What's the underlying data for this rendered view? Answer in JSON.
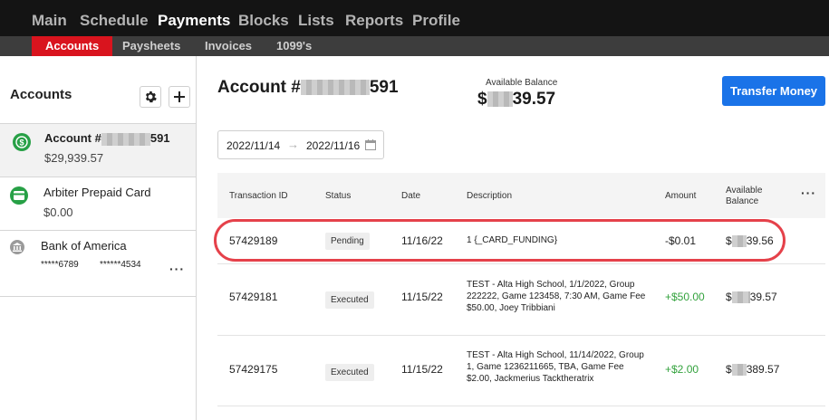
{
  "top_nav": [
    "Main",
    "Schedule",
    "Payments",
    "Blocks",
    "Lists",
    "Reports",
    "Profile"
  ],
  "sub_nav": [
    "Accounts",
    "Paysheets",
    "Invoices",
    "1099's"
  ],
  "sidebar": {
    "title": "Accounts",
    "accounts": [
      {
        "name_prefix": "Account #",
        "name_suffix": "591",
        "balance": "$29,939.57",
        "icon": "dollar-circle-icon"
      },
      {
        "name": "Arbiter Prepaid Card",
        "balance": "$0.00",
        "icon": "card-icon"
      },
      {
        "name": "Bank of America",
        "num1": "*****6789",
        "num2": "******4534",
        "icon": "bank-icon"
      }
    ]
  },
  "main": {
    "title_prefix": "Account #",
    "title_suffix": "591",
    "avail_label": "Available Balance",
    "avail_prefix": "$",
    "avail_suffix": "39.57",
    "transfer_label": "Transfer Money",
    "date_from": "2022/11/14",
    "date_to": "2022/11/16"
  },
  "table": {
    "headers": [
      "Transaction ID",
      "Status",
      "Date",
      "Description",
      "Amount",
      "Available",
      "Balance"
    ],
    "rows": [
      {
        "id": "57429189",
        "status": "Pending",
        "date": "11/16/22",
        "desc": "1 {_CARD_FUNDING}",
        "amount": "-$0.01",
        "bal_prefix": "$",
        "bal_suffix": "39.56"
      },
      {
        "id": "57429181",
        "status": "Executed",
        "date": "11/15/22",
        "desc": "TEST - Alta High School, 1/1/2022, Group 222222, Game 123458, 7:30 AM, Game Fee $50.00, Joey Tribbiani",
        "amount": "+$50.00",
        "bal_prefix": "$",
        "bal_suffix": "39.57"
      },
      {
        "id": "57429175",
        "status": "Executed",
        "date": "11/15/22",
        "desc": "TEST - Alta High School, 11/14/2022, Group 1, Game 1236211665, TBA, Game Fee $2.00, Jackmerius Tacktheratrix",
        "amount": "+$2.00",
        "bal_prefix": "$",
        "bal_suffix": "389.57"
      }
    ]
  },
  "colors": {
    "accent_red": "#d9141e",
    "button_blue": "#1a73e8",
    "positive_green": "#33a23d",
    "highlight_red": "#e5414a"
  }
}
